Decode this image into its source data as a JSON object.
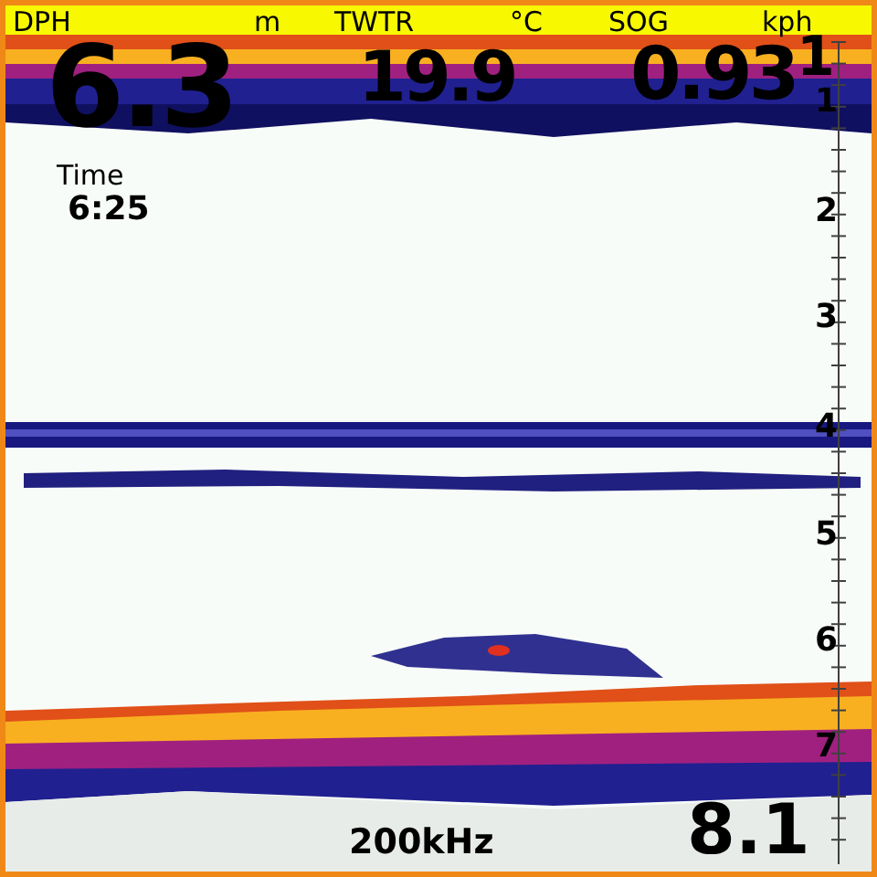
{
  "readouts": [
    {
      "label": "DPH",
      "unit": "m",
      "value": "6.3"
    },
    {
      "label": "TWTR",
      "unit": "°C",
      "value": "19.9"
    },
    {
      "label": "SOG",
      "unit": "kph",
      "value": "0.93"
    }
  ],
  "time": {
    "label": "Time",
    "value": "6:25"
  },
  "depth_scale": [
    "1",
    "1",
    "2",
    "3",
    "4",
    "5",
    "6",
    "7"
  ],
  "frequency": "200kHz",
  "bottom_depth": "8.1"
}
